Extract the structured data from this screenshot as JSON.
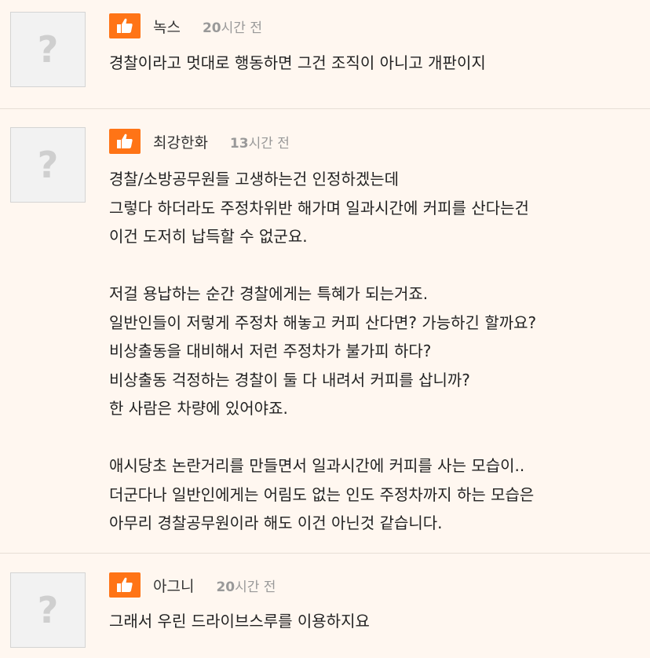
{
  "colors": {
    "accent": "#ff7416",
    "background": "#fff7f0",
    "divider": "#e6ded6"
  },
  "comments": [
    {
      "avatar_glyph": "?",
      "like_icon": "thumbs-up-icon",
      "nickname": "녹스",
      "time_number": "20",
      "time_unit": "시간 전",
      "text": "경찰이라고 멋대로 행동하면 그건 조직이 아니고 개판이지"
    },
    {
      "avatar_glyph": "?",
      "like_icon": "thumbs-up-icon",
      "nickname": "최강한화",
      "time_number": "13",
      "time_unit": "시간 전",
      "text": "경찰/소방공무원들 고생하는건 인정하겠는데\n그렇다 하더라도 주정차위반 해가며 일과시간에 커피를 산다는건\n이건 도저히 납득할 수 없군요.\n\n저걸 용납하는 순간 경찰에게는 특혜가 되는거죠.\n일반인들이 저렇게 주정차 해놓고 커피 산다면? 가능하긴 할까요?\n비상출동을 대비해서 저런 주정차가 불가피 하다?\n비상출동 걱정하는 경찰이 둘 다 내려서 커피를 삽니까?\n한 사람은 차량에 있어야죠.\n\n애시당초 논란거리를 만들면서 일과시간에 커피를 사는 모습이..\n더군다나 일반인에게는 어림도 없는 인도 주정차까지 하는 모습은\n아무리 경찰공무원이라 해도 이건 아닌것 같습니다."
    },
    {
      "avatar_glyph": "?",
      "like_icon": "thumbs-up-icon",
      "nickname": "아그니",
      "time_number": "20",
      "time_unit": "시간 전",
      "text": "그래서 우린 드라이브스루를 이용하지요"
    }
  ]
}
